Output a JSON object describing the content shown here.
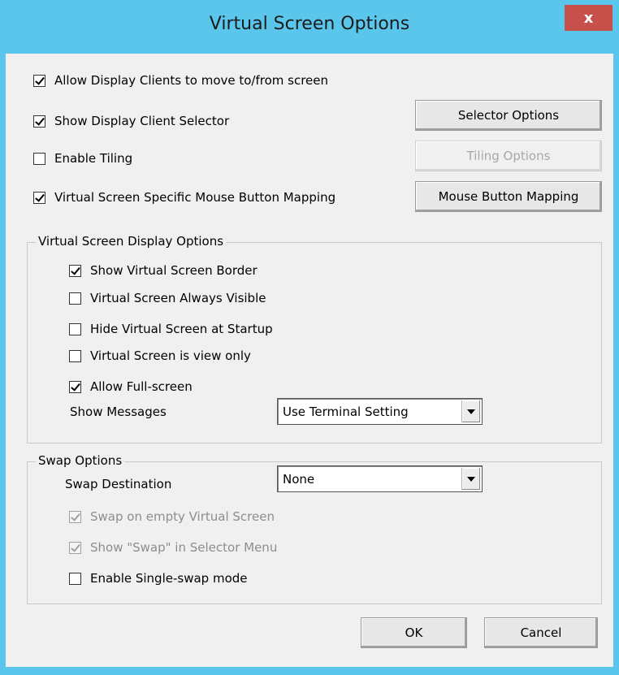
{
  "window": {
    "title": "Virtual Screen Options",
    "close_label": "x"
  },
  "options": [
    {
      "label": "Allow Display Clients to move to/from screen",
      "checked": true
    },
    {
      "label": "Show Display Client Selector",
      "checked": true
    },
    {
      "label": "Enable Tiling",
      "checked": false
    },
    {
      "label": "Virtual Screen Specific Mouse Button Mapping",
      "checked": true
    }
  ],
  "buttons": {
    "selector_options": "Selector Options",
    "tiling_options": "Tiling Options",
    "mouse_button_mapping": "Mouse Button Mapping",
    "ok": "OK",
    "cancel": "Cancel"
  },
  "display_group": {
    "label": "Virtual Screen Display Options",
    "items": [
      {
        "label": "Show Virtual Screen Border",
        "checked": true
      },
      {
        "label": "Virtual Screen Always Visible",
        "checked": false
      },
      {
        "label": "Hide Virtual Screen at Startup",
        "checked": false
      },
      {
        "label": "Virtual Screen is view only",
        "checked": false
      },
      {
        "label": "Allow Full-screen",
        "checked": true
      }
    ],
    "show_messages_label": "Show Messages",
    "show_messages_value": "Use Terminal Setting"
  },
  "swap_group": {
    "label": "Swap Options",
    "destination_label": "Swap Destination",
    "destination_value": "None",
    "items": [
      {
        "label": "Swap on empty Virtual Screen",
        "checked": true,
        "disabled": true
      },
      {
        "label": "Show \"Swap\" in Selector Menu",
        "checked": true,
        "disabled": true
      },
      {
        "label": "Enable Single-swap mode",
        "checked": false,
        "disabled": false
      }
    ]
  },
  "colors": {
    "title_bar": "#5bc6ec",
    "close_button": "#c7504b",
    "dialog_bg": "#f0f0f0"
  }
}
